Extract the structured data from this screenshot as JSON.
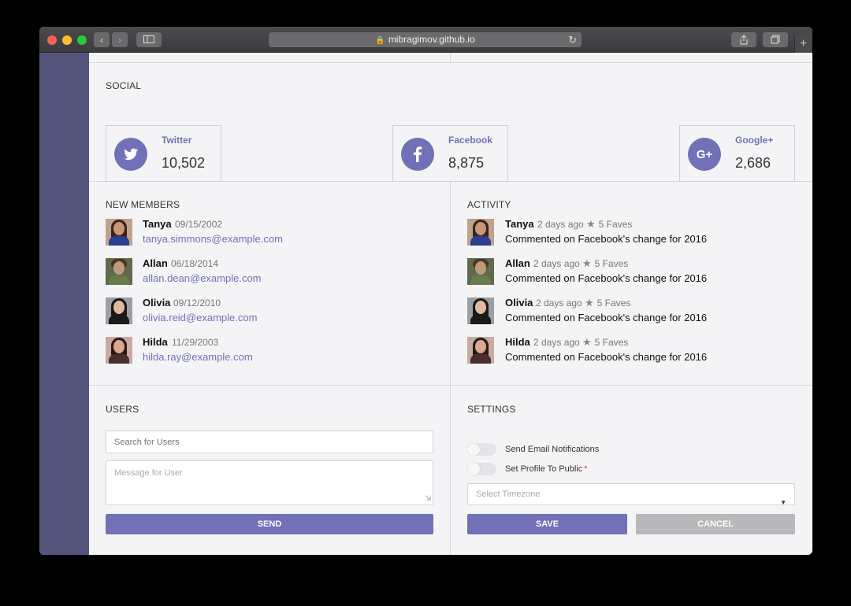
{
  "browser": {
    "url": "mibragimov.github.io",
    "back_icon": "chevron-left-icon",
    "forward_icon": "chevron-right-icon"
  },
  "social": {
    "title": "SOCIAL",
    "cards": [
      {
        "name": "Twitter",
        "count": "10,502",
        "icon": "twitter-icon"
      },
      {
        "name": "Facebook",
        "count": "8,875",
        "icon": "facebook-icon"
      },
      {
        "name": "Google+",
        "count": "2,686",
        "icon": "google-plus-icon"
      }
    ]
  },
  "new_members": {
    "title": "NEW MEMBERS",
    "items": [
      {
        "name": "Tanya",
        "date": "09/15/2002",
        "email": "tanya.simmons@example.com"
      },
      {
        "name": "Allan",
        "date": "06/18/2014",
        "email": "allan.dean@example.com"
      },
      {
        "name": "Olivia",
        "date": "09/12/2010",
        "email": "olivia.reid@example.com"
      },
      {
        "name": "Hilda",
        "date": "11/29/2003",
        "email": "hilda.ray@example.com"
      }
    ]
  },
  "activity": {
    "title": "ACTIVITY",
    "items": [
      {
        "name": "Tanya",
        "time": "2 days ago",
        "faves": "5 Faves",
        "text": "Commented on Facebook's change for 2016"
      },
      {
        "name": "Allan",
        "time": "2 days ago",
        "faves": "5 Faves",
        "text": "Commented on Facebook's change for 2016"
      },
      {
        "name": "Olivia",
        "time": "2 days ago",
        "faves": "5 Faves",
        "text": "Commented on Facebook's change for 2016"
      },
      {
        "name": "Hilda",
        "time": "2 days ago",
        "faves": "5 Faves",
        "text": "Commented on Facebook's change for 2016"
      }
    ]
  },
  "users": {
    "title": "USERS",
    "search_placeholder": "Search for Users",
    "message_placeholder": "Message for User",
    "send_label": "SEND"
  },
  "settings": {
    "title": "SETTINGS",
    "email_notifications_label": "Send Email Notifications",
    "profile_public_label": "Set Profile To Public",
    "required_mark": "*",
    "timezone_placeholder": "Select Timezone",
    "save_label": "SAVE",
    "cancel_label": "CANCEL"
  },
  "colors": {
    "accent": "#7071b7",
    "sidebar": "#54547a",
    "cancel": "#b9b9bc"
  }
}
